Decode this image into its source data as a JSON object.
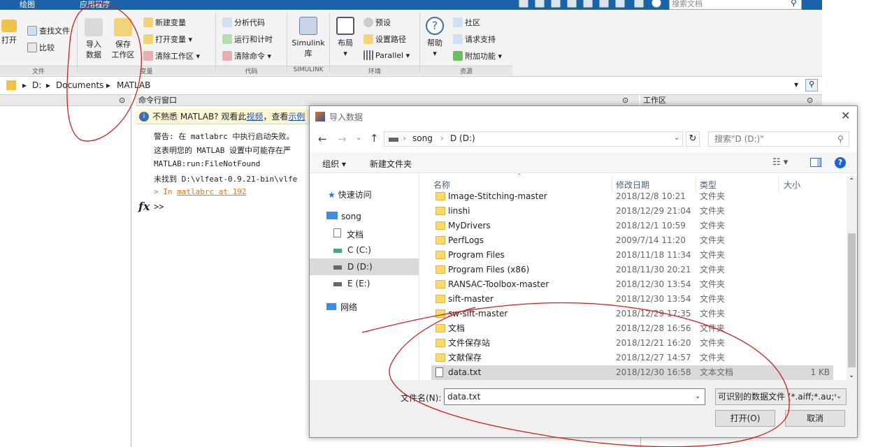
{
  "topbar": {
    "tab_plot": "绘图",
    "tab_apps": "应用程序",
    "search_placeholder": "搜索文档"
  },
  "ribbon": {
    "open": "打开",
    "find_files": "查找文件",
    "compare": "比较",
    "import_data": "导入\n数据",
    "import_l1": "导入",
    "import_l2": "数据",
    "save_l1": "保存",
    "save_l2": "工作区",
    "new_var": "新建变量",
    "open_var": "打开变量",
    "clear_ws": "清除工作区",
    "analyze_code": "分析代码",
    "run_time": "运行和计时",
    "clear_cmd": "清除命令",
    "simulink_l1": "Simulink",
    "simulink_l2": "库",
    "layout": "布局",
    "prefs": "预设",
    "set_path": "设置路径",
    "parallel": "Parallel",
    "help": "帮助",
    "community": "社区",
    "request_support": "请求支持",
    "addons": "附加功能",
    "groups": {
      "file": "文件",
      "variable": "变量",
      "code": "代码",
      "simulink": "SIMULINK",
      "env": "环境",
      "resources": "资源"
    }
  },
  "address": {
    "drive": "D:",
    "p1": "Documents",
    "p2": "MATLAB"
  },
  "panels": {
    "cmd_title": "命令行窗口",
    "ws_title": "工作区"
  },
  "cmd": {
    "info_text": "不熟悉 MATLAB? 观看此",
    "info_link": "视频",
    "info_rest": "，查看",
    "info_link2": "示例",
    "line1": "警告: 在 matlabrc 中执行启动失败。",
    "line2": "这表明您的 MATLAB 设置中可能存在严",
    "line3": "MATLAB:run:FileNotFound",
    "line4": "未找到 D:\\vlfeat-0.9.21-bin\\vlfe",
    "line5_pre": "> In ",
    "line5_link": "matlabrc at 192",
    "fx": "fx",
    "prompt": ">>"
  },
  "dialog": {
    "title": "导入数据",
    "breadcrumb": [
      "song",
      "D (D:)"
    ],
    "search_placeholder": "搜索\"D (D:)\"",
    "organize": "组织",
    "new_folder": "新建文件夹",
    "cols": {
      "name": "名称",
      "date": "修改日期",
      "type": "类型",
      "size": "大小"
    },
    "nav": [
      {
        "label": "快速访问"
      },
      {
        "label": "song"
      },
      {
        "label": "文档"
      },
      {
        "label": "C (C:)"
      },
      {
        "label": "D (D:)"
      },
      {
        "label": "E (E:)"
      },
      {
        "label": "网络"
      }
    ],
    "files": [
      {
        "name": "Image-Stitching-master",
        "date": "2018/12/8 10:21",
        "type": "文件夹",
        "size": ""
      },
      {
        "name": "linshi",
        "date": "2018/12/29 21:04",
        "type": "文件夹",
        "size": ""
      },
      {
        "name": "MyDrivers",
        "date": "2018/12/1 10:59",
        "type": "文件夹",
        "size": ""
      },
      {
        "name": "PerfLogs",
        "date": "2009/7/14 11:20",
        "type": "文件夹",
        "size": ""
      },
      {
        "name": "Program Files",
        "date": "2018/11/18 11:34",
        "type": "文件夹",
        "size": ""
      },
      {
        "name": "Program Files (x86)",
        "date": "2018/11/30 20:21",
        "type": "文件夹",
        "size": ""
      },
      {
        "name": "RANSAC-Toolbox-master",
        "date": "2018/12/30 13:54",
        "type": "文件夹",
        "size": ""
      },
      {
        "name": "sift-master",
        "date": "2018/12/30 13:54",
        "type": "文件夹",
        "size": ""
      },
      {
        "name": "sw-sift-master",
        "date": "2018/12/29 17:35",
        "type": "文件夹",
        "size": ""
      },
      {
        "name": "文档",
        "date": "2018/12/28 16:56",
        "type": "文件夹",
        "size": ""
      },
      {
        "name": "文件保存站",
        "date": "2018/12/21 16:20",
        "type": "文件夹",
        "size": ""
      },
      {
        "name": "文献保存",
        "date": "2018/12/27 14:57",
        "type": "文件夹",
        "size": ""
      },
      {
        "name": "data.txt",
        "date": "2018/12/30 16:58",
        "type": "文本文档",
        "size": "1 KB"
      }
    ],
    "filename_label": "文件名(N):",
    "filename_value": "data.txt",
    "filter_value": "可识别的数据文件 (*.aiff;*.au;*",
    "open_btn": "打开(O)",
    "cancel_btn": "取消"
  }
}
